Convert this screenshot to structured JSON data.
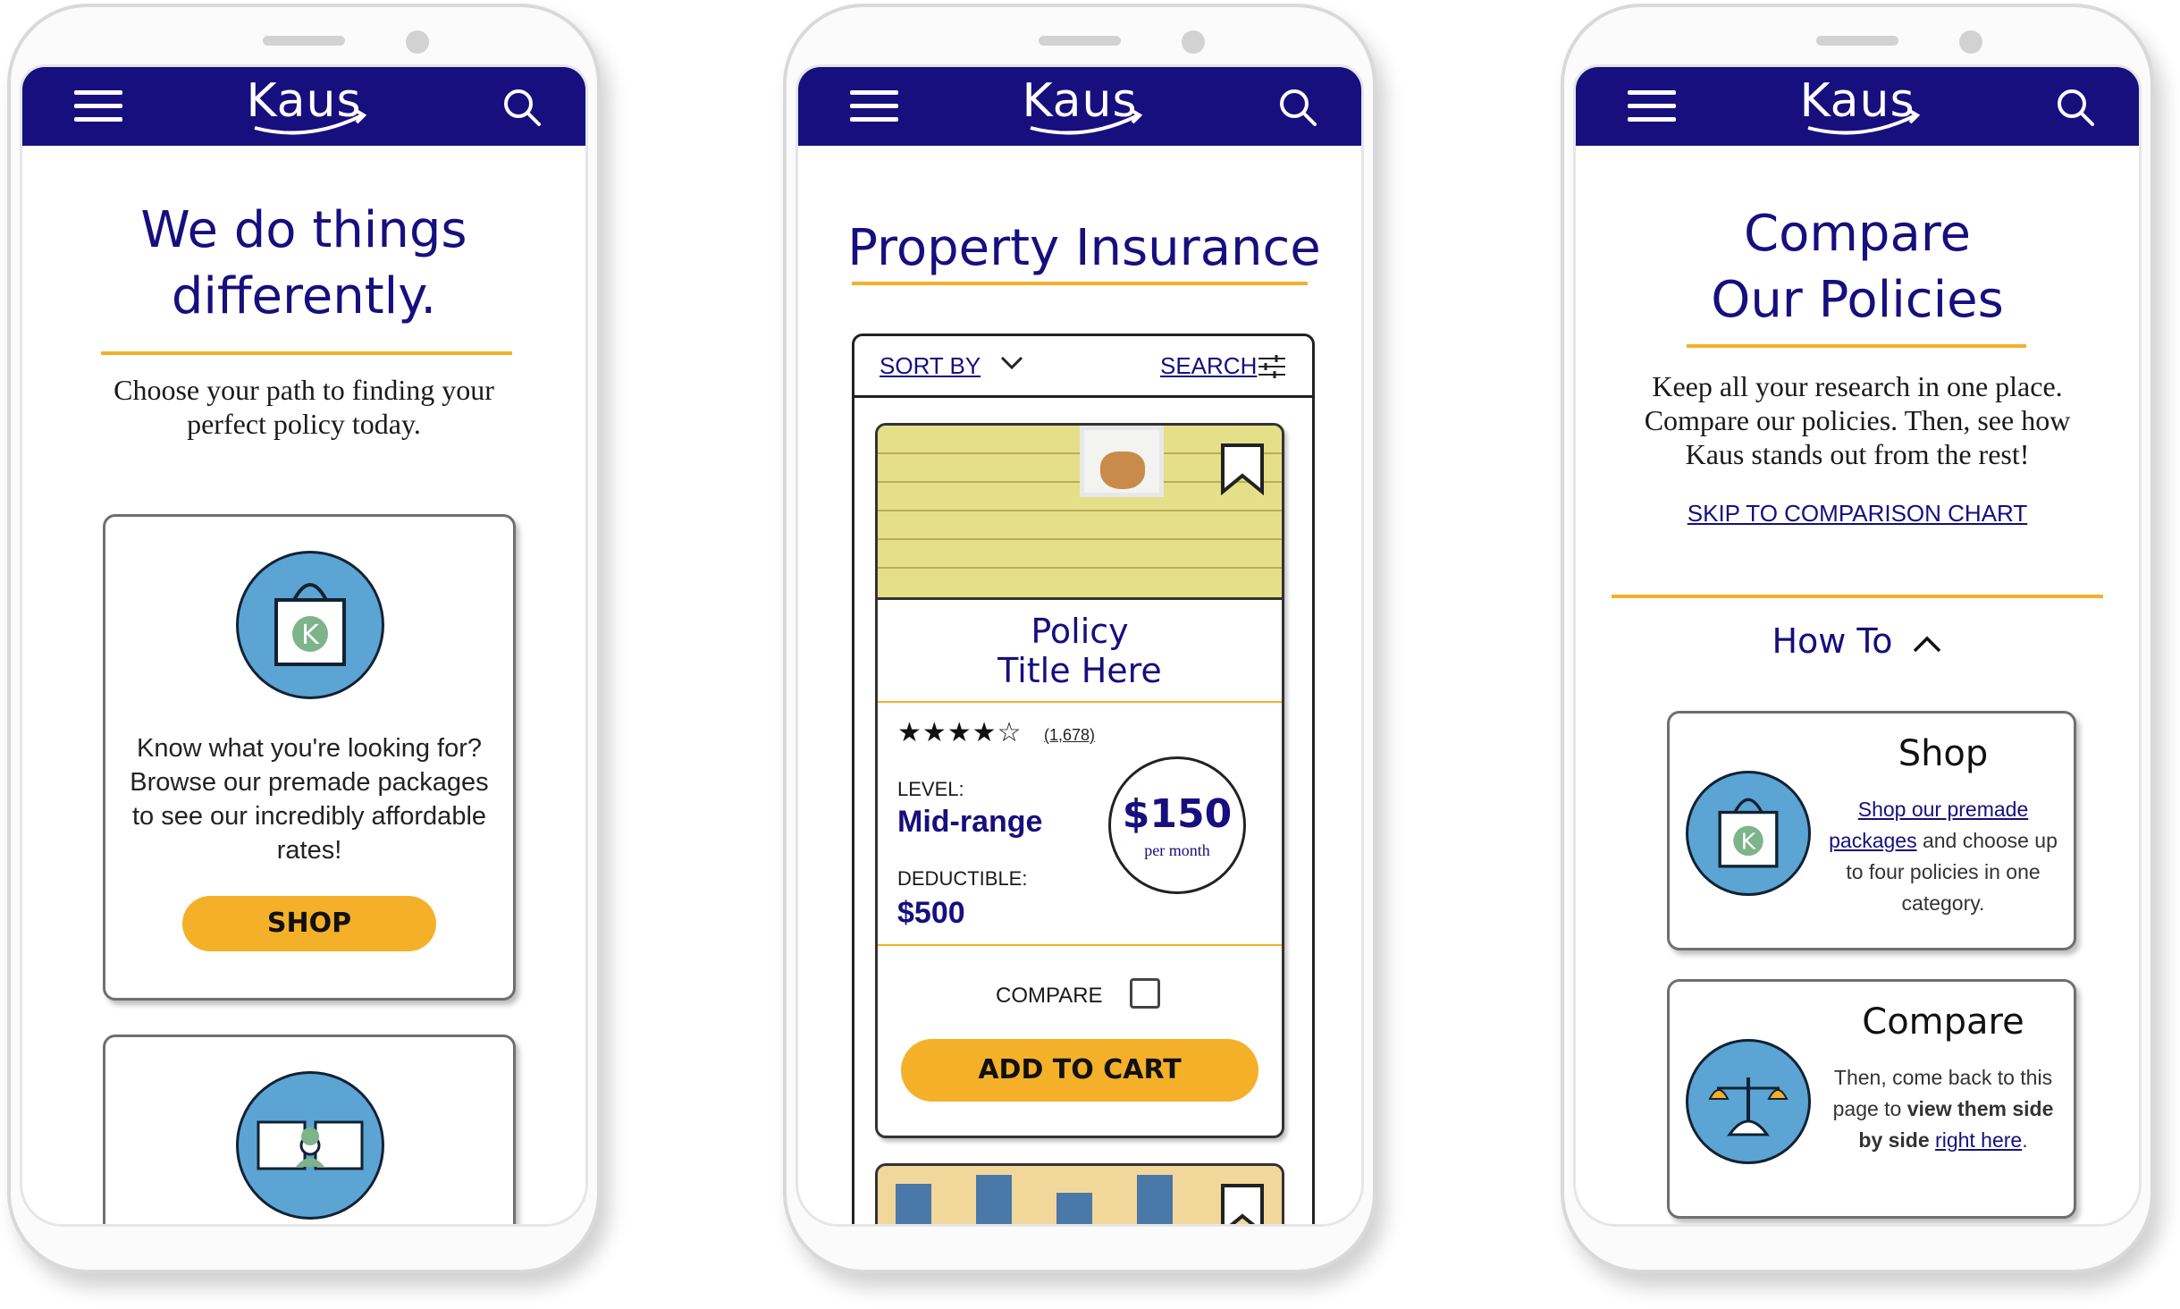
{
  "app": {
    "brand": "Kaus"
  },
  "colors": {
    "navy": "#170f7e",
    "gold": "#f5b029",
    "icon_blue": "#5ba4d3",
    "icon_green": "#7db48a"
  },
  "icons": [
    "menu-icon",
    "search-icon",
    "shopping-bag-icon",
    "puzzle-icon",
    "chevron-down-icon",
    "filter-sliders-icon",
    "bookmark-icon",
    "chevron-up-icon",
    "scale-icon"
  ],
  "screen1": {
    "title": "We do things differently.",
    "subtitle": "Choose your path to finding your perfect policy today.",
    "card": {
      "text": "Know what you're looking for? Browse our premade packages to see our incredibly affordable rates!",
      "button": "SHOP"
    }
  },
  "screen2": {
    "title": "Property Insurance",
    "sort_label": "SORT BY",
    "search_label": "SEARCH",
    "policy": {
      "title_line1": "Policy",
      "title_line2": "Title Here",
      "stars": "★★★★☆",
      "rating": 4,
      "reviews": "(1,678)",
      "level_label": "LEVEL:",
      "level": "Mid-range",
      "deductible_label": "DEDUCTIBLE:",
      "deductible": "$500",
      "price": "$150",
      "price_unit": "per month",
      "compare_label": "COMPARE",
      "compare_checked": false,
      "add_button": "ADD TO CART"
    }
  },
  "screen3": {
    "title_line1": "Compare",
    "title_line2": "Our Policies",
    "subtitle": "Keep all your research in one place. Compare our policies. Then, see how Kaus stands out from the rest!",
    "skip_link": "SKIP TO COMPARISON CHART",
    "howto": "How To",
    "shop_card": {
      "title": "Shop",
      "link": "Shop our premade packages",
      "text": "and choose up to four policies in one category."
    },
    "compare_card": {
      "title": "Compare",
      "text_a": "Then, come back to this page to",
      "text_b": "view them side by side",
      "link": "right here",
      "text_c": "."
    }
  }
}
